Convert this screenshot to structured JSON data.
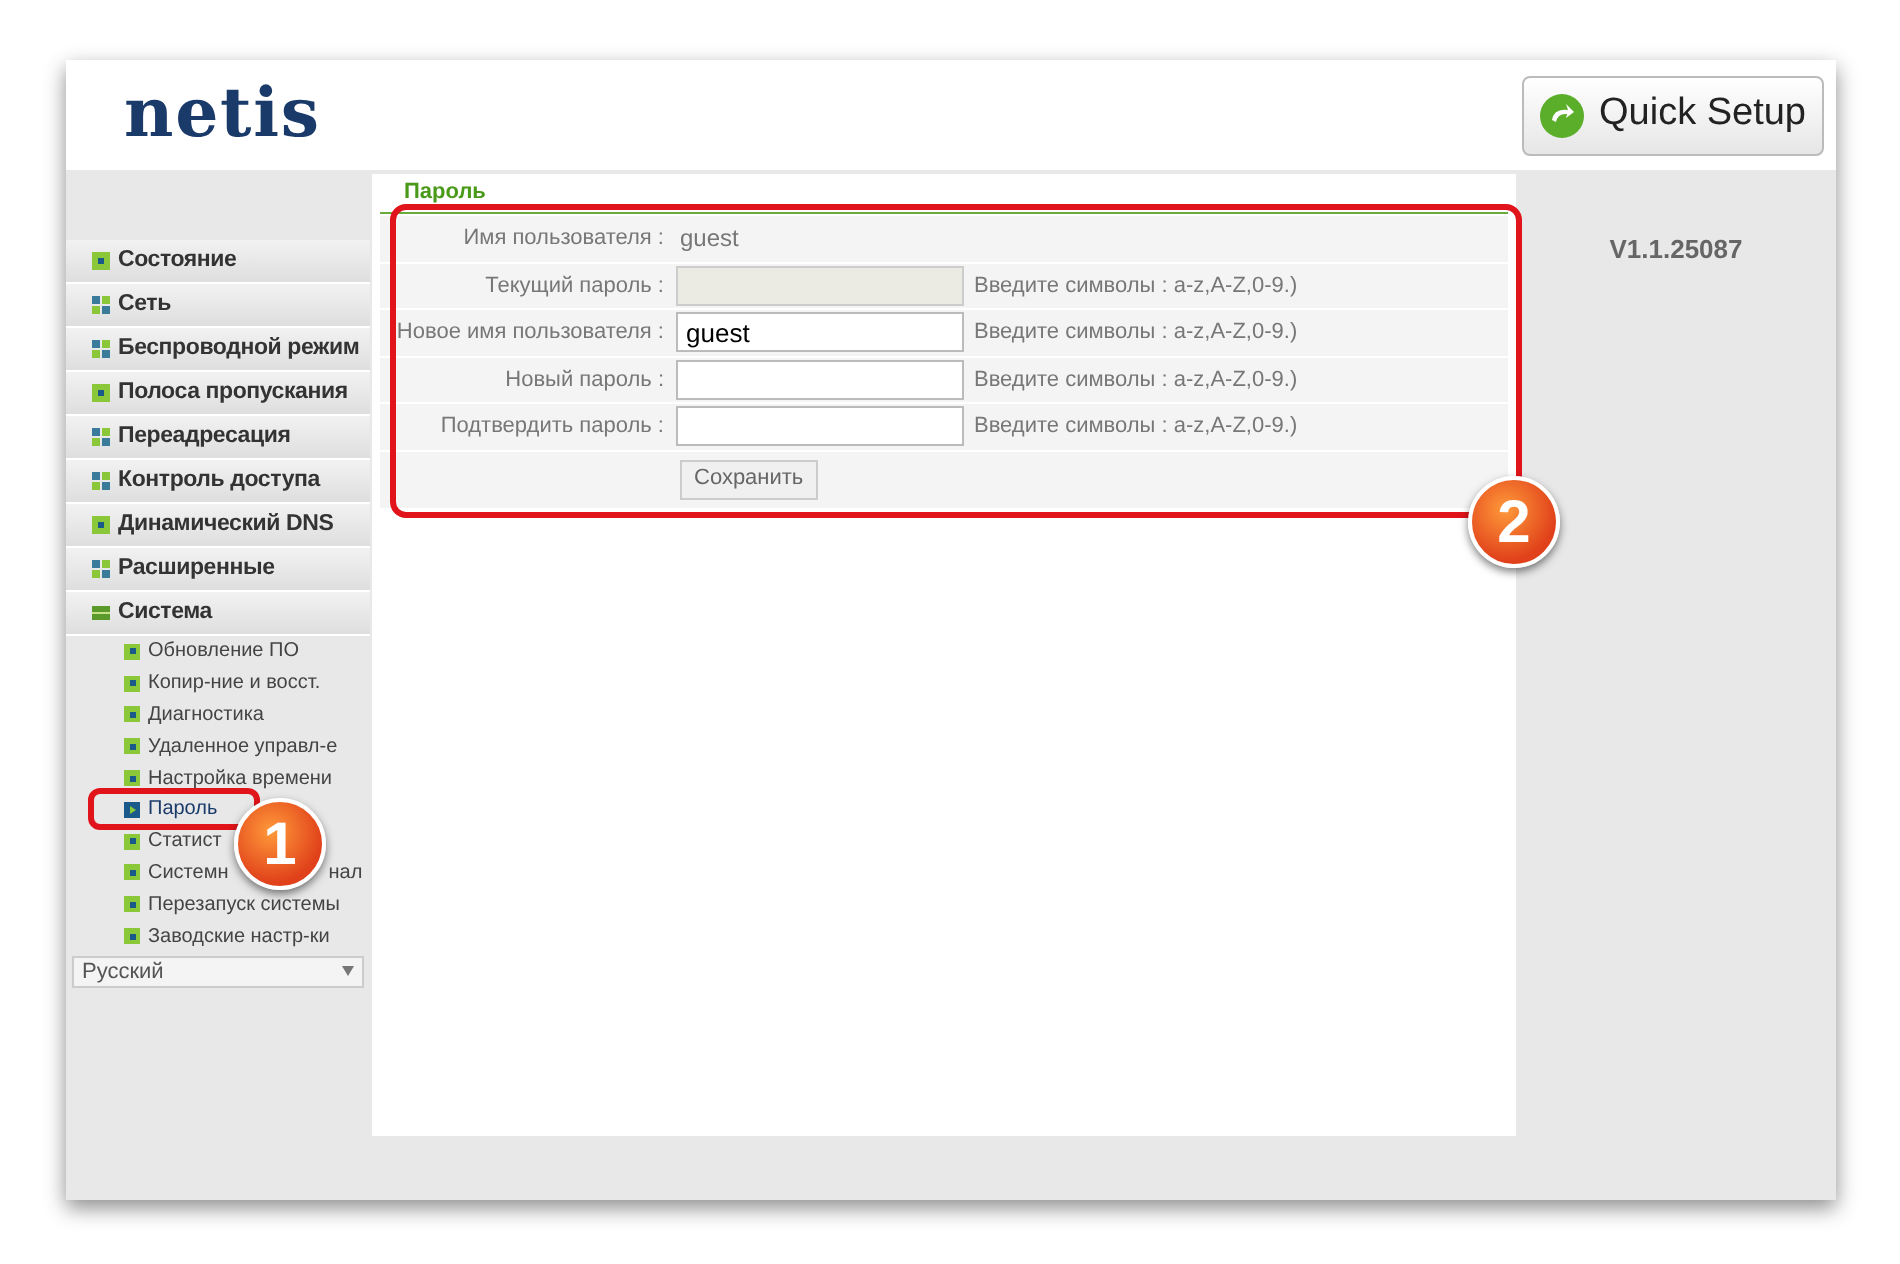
{
  "header": {
    "logo": "netis",
    "quick_setup": "Quick Setup"
  },
  "version": "V1.1.25087",
  "menu": [
    {
      "label": "Состояние",
      "kind": "single",
      "expanded": false
    },
    {
      "label": "Сеть",
      "kind": "group",
      "expanded": false
    },
    {
      "label": "Беспроводной режим",
      "kind": "group",
      "expanded": false
    },
    {
      "label": "Полоса пропускания",
      "kind": "single",
      "expanded": false
    },
    {
      "label": "Переадресация",
      "kind": "group",
      "expanded": false
    },
    {
      "label": "Контроль доступа",
      "kind": "group",
      "expanded": false
    },
    {
      "label": "Динамический DNS",
      "kind": "single",
      "expanded": false
    },
    {
      "label": "Расширенные",
      "kind": "group",
      "expanded": false
    },
    {
      "label": "Система",
      "kind": "group",
      "expanded": true,
      "children": [
        {
          "label": "Обновление ПО",
          "selected": false
        },
        {
          "label": "Копир-ние и восст.",
          "selected": false
        },
        {
          "label": "Диагностика",
          "selected": false
        },
        {
          "label": "Удаленное управл-е",
          "selected": false
        },
        {
          "label": "Настройка времени",
          "selected": false
        },
        {
          "label": "Пароль",
          "selected": true
        },
        {
          "label": "Статист",
          "selected": false
        },
        {
          "label": "Системн",
          "label_after": "нал",
          "selected": false
        },
        {
          "label": "Перезапуск системы",
          "selected": false
        },
        {
          "label": "Заводские настр-ки",
          "selected": false
        }
      ]
    }
  ],
  "language": "Русский",
  "section_title": "Пароль",
  "form": [
    {
      "label": "Имя пользователя :",
      "kind": "text",
      "value": "guest"
    },
    {
      "label": "Текущий пароль :",
      "kind": "input",
      "disabled": true,
      "hint": "Введите символы : a-z,A-Z,0-9.)"
    },
    {
      "label": "Новое имя пользователя :",
      "kind": "input",
      "disabled": false,
      "value": "guest",
      "hint": "Введите символы : a-z,A-Z,0-9.)"
    },
    {
      "label": "Новый пароль :",
      "kind": "input",
      "disabled": false,
      "hint": "Введите символы : a-z,A-Z,0-9.)"
    },
    {
      "label": "Подтвердить пароль :",
      "kind": "input",
      "disabled": false,
      "hint": "Введите символы : a-z,A-Z,0-9.)"
    }
  ],
  "save_button": "Сохранить",
  "callouts": [
    "1",
    "2"
  ]
}
